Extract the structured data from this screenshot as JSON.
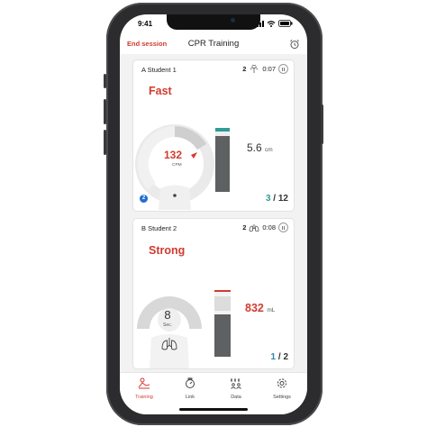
{
  "status_bar": {
    "time": "9:41"
  },
  "header": {
    "end_label": "End session",
    "title": "CPR Training"
  },
  "cards": [
    {
      "name": "A Student 1",
      "stat_count": "2",
      "timer": "0:07",
      "state": "Fast",
      "rate_value": "132",
      "rate_unit": "CPM",
      "badge": "2",
      "measure_value": "5.6",
      "measure_unit": "cm",
      "count_done": "3",
      "count_sep": " / ",
      "count_total": "12",
      "depth_fill": 0.95
    },
    {
      "name": "B Student 2",
      "stat_count": "2",
      "timer": "0:08",
      "state": "Strong",
      "sec_value": "8",
      "sec_unit": "Sec.",
      "measure_value": "832",
      "measure_unit": "mL",
      "count_done": "1",
      "count_sep": " / ",
      "count_total": "2",
      "volume_fill": 0.6
    }
  ],
  "tabs": [
    {
      "label": "Training",
      "icon": "cpr-icon",
      "active": true
    },
    {
      "label": "Link",
      "icon": "link-icon",
      "active": false
    },
    {
      "label": "Data",
      "icon": "data-icon",
      "active": false
    },
    {
      "label": "Settings",
      "icon": "gear-icon",
      "active": false
    }
  ],
  "colors": {
    "accent": "#d13b2f",
    "teal": "#2f9c95",
    "blue": "#2f80b5",
    "bar": "#5f6061"
  }
}
